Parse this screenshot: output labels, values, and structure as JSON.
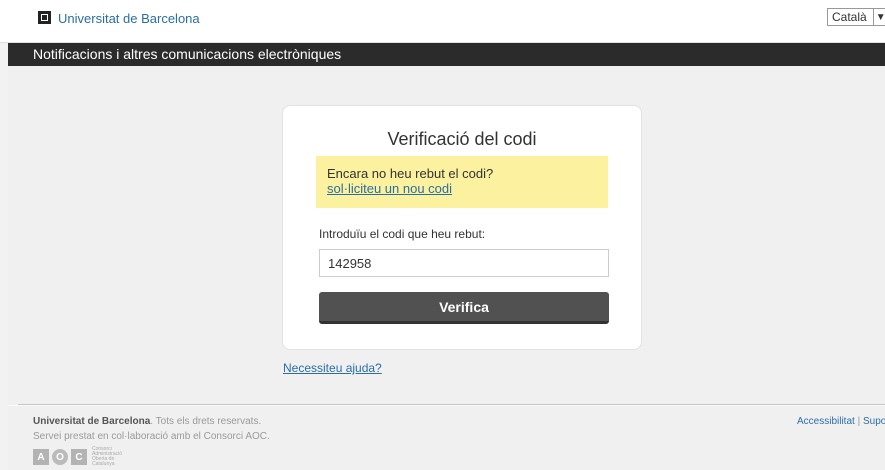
{
  "header": {
    "university_link": "Universitat de Barcelona",
    "language": {
      "selected": "Català"
    }
  },
  "titlebar": {
    "title": "Notificacions i altres comunicacions electròniques"
  },
  "card": {
    "title": "Verificació del codi",
    "notice": {
      "text": "Encara no heu rebut el codi?",
      "link": "sol·liciteu un nou codi"
    },
    "code_label": "Introduïu el codi que heu rebut:",
    "code_value": "142958",
    "verify_button": "Verifica"
  },
  "help_link": "Necessiteu ajuda?",
  "footer": {
    "org": "Universitat de Barcelona",
    "rights": ". Tots els drets reservats.",
    "service": "Servei prestat en col·laboració amb el Consorci AOC.",
    "accessibility": "Accessibilitat",
    "separator": "|",
    "support": "Suport",
    "aoc_letters": [
      "A",
      "O",
      "C"
    ],
    "aoc_subtitle": "Consorci Administració Oberta de Catalunya"
  }
}
